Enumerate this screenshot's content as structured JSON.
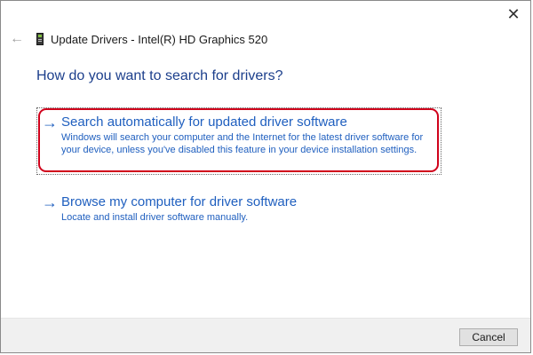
{
  "window": {
    "title": "Update Drivers - Intel(R) HD Graphics 520",
    "close_glyph": "✕",
    "back_glyph": "←"
  },
  "heading": "How do you want to search for drivers?",
  "options": [
    {
      "label": "Search automatically for updated driver software",
      "description": "Windows will search your computer and the Internet for the latest driver software for your device, unless you've disabled this feature in your device installation settings.",
      "arrow": "→",
      "highlighted": true
    },
    {
      "label": "Browse my computer for driver software",
      "description": "Locate and install driver software manually.",
      "arrow": "→",
      "highlighted": false
    }
  ],
  "footer": {
    "cancel_label": "Cancel"
  },
  "colors": {
    "link_blue": "#1f5fbf",
    "heading_blue": "#1c3f8c",
    "highlight_red": "#d0021b"
  }
}
